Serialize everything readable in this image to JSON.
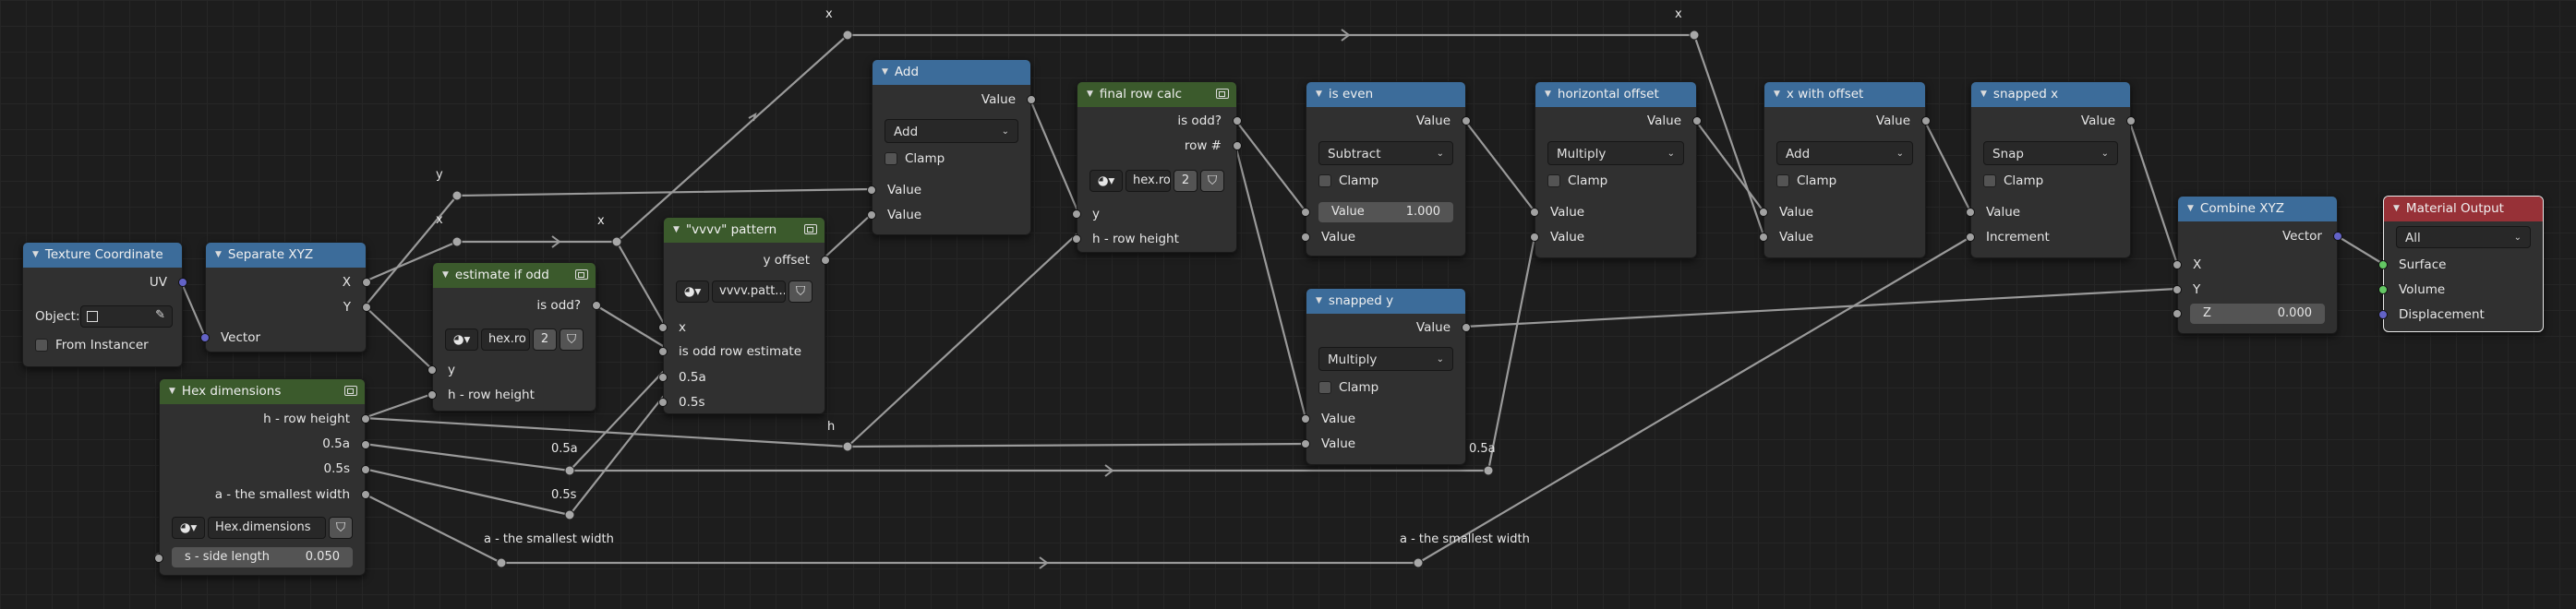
{
  "colors": {
    "input_header": "#3c6c9a",
    "output_header": "#973137",
    "group_header": "#3b5a2c",
    "socket_float": "#a1a1a1",
    "socket_vector": "#6363c7",
    "socket_shader": "#63c763",
    "wire": "#9a9a9a"
  },
  "nodes": {
    "texture_coordinate": {
      "title": "Texture Coordinate",
      "out_uv": "UV",
      "object_label": "Object:",
      "from_instancer": "From Instancer"
    },
    "separate_xyz": {
      "title": "Separate XYZ",
      "out_x": "X",
      "out_y": "Y",
      "in_vector": "Vector"
    },
    "hex_dimensions": {
      "title": "Hex dimensions",
      "out_h": "h - row height",
      "out_05a": "0.5a",
      "out_05s": "0.5s",
      "out_a": "a - the smallest width",
      "group_name": "Hex.dimensions",
      "s_label": "s - side length",
      "s_value": "0.050"
    },
    "estimate_odd": {
      "title": "estimate if odd",
      "out_is_odd": "is odd?",
      "group_name": "hex.ro",
      "users": "2",
      "in_y": "y",
      "in_h": "h - row height"
    },
    "vvvv_pattern": {
      "title": "\"vvvv\" pattern",
      "out_y_offset": "y offset",
      "group_name": "vvvv.patt...",
      "in_x": "x",
      "in_odd": "is odd row estimate",
      "in_05a": "0.5a",
      "in_05s": "0.5s"
    },
    "add": {
      "title": "Add",
      "out_value": "Value",
      "operation": "Add",
      "clamp": "Clamp",
      "in_value1": "Value",
      "in_value2": "Value"
    },
    "final_row_calc": {
      "title": "final row calc",
      "out_is_odd": "is odd?",
      "out_row": "row #",
      "group_name": "hex.ro",
      "users": "2",
      "in_y": "y",
      "in_h": "h - row height"
    },
    "is_even": {
      "title": "is even",
      "out_value": "Value",
      "operation": "Subtract",
      "clamp": "Clamp",
      "value_label": "Value",
      "value_num": "1.000",
      "in_value": "Value"
    },
    "snapped_y": {
      "title": "snapped y",
      "out_value": "Value",
      "operation": "Multiply",
      "clamp": "Clamp",
      "in_value1": "Value",
      "in_value2": "Value"
    },
    "horizontal_offset": {
      "title": "horizontal offset",
      "out_value": "Value",
      "operation": "Multiply",
      "clamp": "Clamp",
      "in_value1": "Value",
      "in_value2": "Value"
    },
    "x_with_offset": {
      "title": "x with offset",
      "out_value": "Value",
      "operation": "Add",
      "clamp": "Clamp",
      "in_value1": "Value",
      "in_value2": "Value"
    },
    "snapped_x": {
      "title": "snapped x",
      "out_value": "Value",
      "operation": "Snap",
      "clamp": "Clamp",
      "in_value": "Value",
      "in_increment": "Increment"
    },
    "combine_xyz": {
      "title": "Combine XYZ",
      "out_vector": "Vector",
      "in_x": "X",
      "in_y": "Y",
      "z_label": "Z",
      "z_value": "0.000"
    },
    "material_output": {
      "title": "Material Output",
      "target": "All",
      "in_surface": "Surface",
      "in_volume": "Volume",
      "in_displacement": "Displacement"
    }
  },
  "reroutes": {
    "x_top_left": "x",
    "x_top_right": "x",
    "y_label": "y",
    "x_mid1": "x",
    "x_mid2": "x",
    "h_label": "h",
    "half_a_1": "0.5a",
    "half_s": "0.5s",
    "half_a_2": "0.5a",
    "a_left": "a - the smallest width",
    "a_right": "a - the smallest width"
  }
}
